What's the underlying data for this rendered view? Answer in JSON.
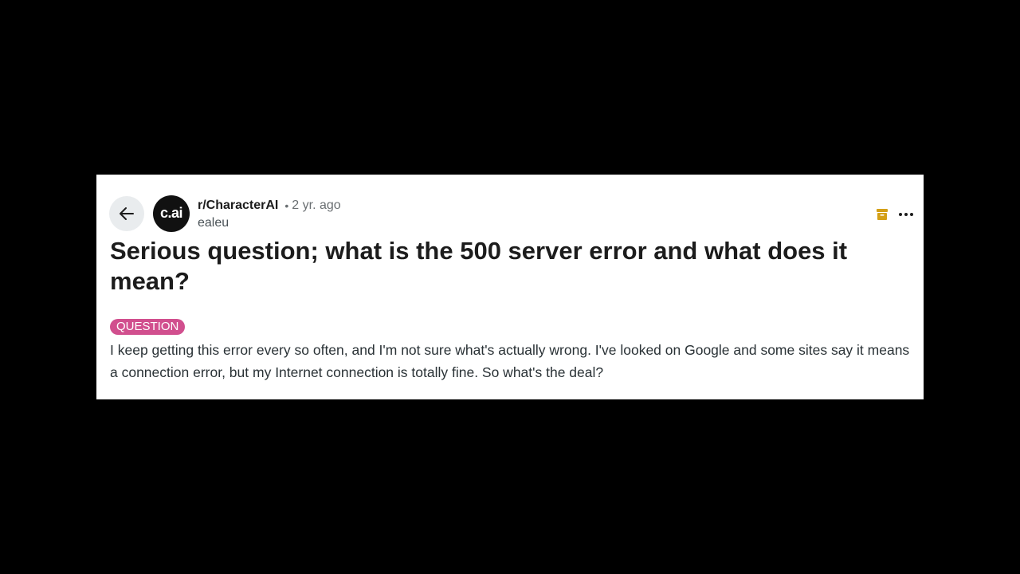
{
  "post": {
    "subreddit": "r/CharacterAI",
    "separator": "•",
    "time": "2 yr. ago",
    "author": "ealeu",
    "avatar_text": "c.ai",
    "title": "Serious question; what is the 500 server error and what does it mean?",
    "flair": "QUESTION",
    "body": "I keep getting this error every so often, and I'm not sure what's actually wrong. I've looked on Google and some sites say it means a connection error, but my Internet connection is totally fine. So what's the deal?"
  },
  "icons": {
    "back": "arrow-left-icon",
    "archive": "archive-icon",
    "more": "more-options-icon"
  },
  "colors": {
    "page_background": "#000000",
    "card_background": "#ffffff",
    "flair_background": "#d14f8e",
    "archive_icon": "#d4a017",
    "back_button_background": "#e9ecee"
  }
}
